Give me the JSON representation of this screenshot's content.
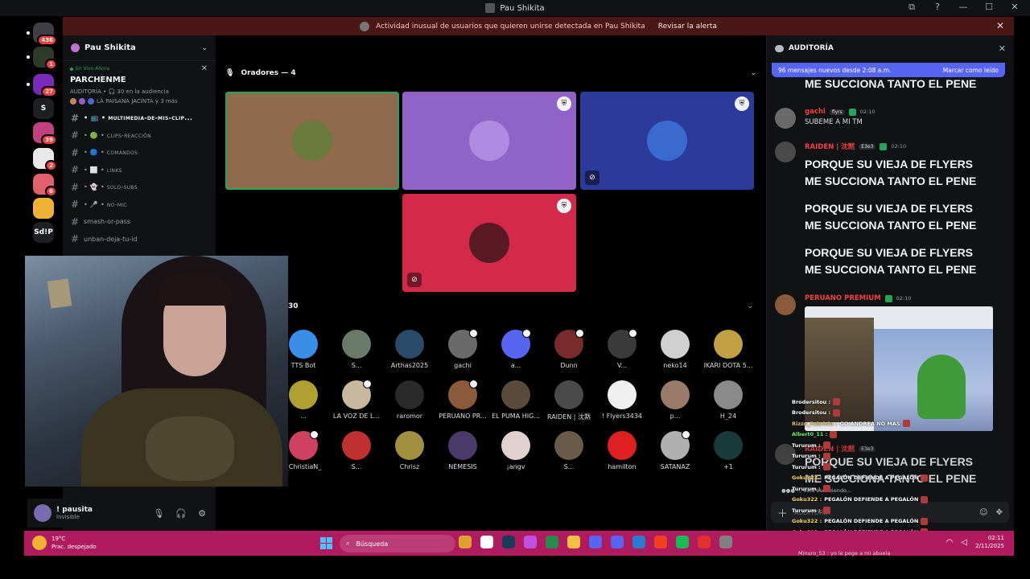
{
  "window": {
    "title": "Pau Shikita",
    "controls": [
      "⧉",
      "?",
      "—",
      "☐",
      "✕"
    ]
  },
  "alert": {
    "text": "Actividad inusual de usuarios que quieren unirse detectada en Pau Shikita",
    "link": "Revisar la alerta"
  },
  "rail": [
    {
      "label": "",
      "badge": "436",
      "color": "#3d3f45"
    },
    {
      "label": "",
      "badge": "1",
      "color": "#2d3a2a"
    },
    {
      "label": "",
      "badge": "27",
      "color": "#7a2ab8"
    },
    {
      "label": "S",
      "badge": "",
      "color": "#1e1f22"
    },
    {
      "label": "",
      "badge": "39",
      "color": "#c04080"
    },
    {
      "label": "",
      "badge": "2",
      "color": "#e8e8e8"
    },
    {
      "label": "",
      "badge": "6",
      "color": "#e06070"
    },
    {
      "label": "",
      "badge": "",
      "color": "#f0b232"
    },
    {
      "label": "Sd!P",
      "badge": "",
      "color": "#1e1f22"
    }
  ],
  "server": {
    "name": "Pau Shikita"
  },
  "live": {
    "tag": "En Vivo Ahora",
    "title": "PARCHENME",
    "meta": "AUDITORÍA • 🎧 30 en la audiencia",
    "hosts": "LA PAISANA JACINTA y 3 más"
  },
  "channels": [
    {
      "name": "• 📺 • multimedia-de-mis-clip...",
      "active": true
    },
    {
      "name": "• 🟢 • clips-reacción",
      "active": false
    },
    {
      "name": "• 🔵 • comandos",
      "active": false
    },
    {
      "name": "• ⬜ • links",
      "active": false
    },
    {
      "name": "• 👻 • solo-subs",
      "active": false
    },
    {
      "name": "• 🎤 • no-mic",
      "active": false
    },
    {
      "name": "smash-or-pass",
      "active": false
    },
    {
      "name": "unban-deja-tu-id",
      "active": false
    }
  ],
  "stage": {
    "speakers_label": "Oradores — 4",
    "tiles": [
      {
        "color": "#8f6a4c",
        "avatar": "#6a7a3a",
        "shield": false,
        "muted": false,
        "speaking": true
      },
      {
        "color": "#9063c9",
        "avatar": "#b08ae0",
        "shield": true,
        "muted": false,
        "speaking": false
      },
      {
        "color": "#2c3a9a",
        "avatar": "#3a6ad0",
        "shield": true,
        "muted": true,
        "speaking": false
      },
      {
        "color": "#d42a4a",
        "avatar": "#5a1a24",
        "shield": true,
        "muted": true,
        "speaking": false
      }
    ],
    "audience_count": "30",
    "audience": [
      {
        "name": "TTS Bot",
        "color": "#3a8ee8",
        "shield": false
      },
      {
        "name": "S...",
        "color": "#6a7a6a",
        "shield": false
      },
      {
        "name": "Arthas2025",
        "color": "#2a4a6a",
        "shield": false
      },
      {
        "name": "gachi",
        "color": "#6a6a6a",
        "shield": true
      },
      {
        "name": "a...",
        "color": "#5865f2",
        "shield": true
      },
      {
        "name": "Dunn",
        "color": "#7a2a2a",
        "shield": true
      },
      {
        "name": "V...",
        "color": "#3a3a3a",
        "shield": true
      },
      {
        "name": "neko14",
        "color": "#d0d0d0",
        "shield": false
      },
      {
        "name": "IKARI DOTA 5...",
        "color": "#c0a040",
        "shield": false
      },
      {
        "name": "...",
        "color": "#b0a030",
        "shield": false
      },
      {
        "name": "LA VOZ DE L...",
        "color": "#c8b8a0",
        "shield": true
      },
      {
        "name": "raromor",
        "color": "#2a2a2a",
        "shield": false
      },
      {
        "name": "PERUANO PR...",
        "color": "#8a5a3a",
        "shield": true
      },
      {
        "name": "EL PUMA HIG...",
        "color": "#5a4a3a",
        "shield": false
      },
      {
        "name": "RAIDEN | 沈黙",
        "color": "#4a4a4a",
        "shield": false
      },
      {
        "name": "! Flyers3434",
        "color": "#f0f0f0",
        "shield": false
      },
      {
        "name": "p...",
        "color": "#9a7a6a",
        "shield": false
      },
      {
        "name": "H_24",
        "color": "#8a8a8a",
        "shield": false
      },
      {
        "name": "_ChristiaN_",
        "color": "#d04060",
        "shield": true
      },
      {
        "name": "S...",
        "color": "#c03030",
        "shield": false
      },
      {
        "name": "Chrisz",
        "color": "#a09040",
        "shield": false
      },
      {
        "name": "NÉMESIS",
        "color": "#4a3a6a",
        "shield": false
      },
      {
        "name": "¡angv",
        "color": "#e0d0d0",
        "shield": false
      },
      {
        "name": "S...",
        "color": "#6a5a4a",
        "shield": false
      },
      {
        "name": "hamilton",
        "color": "#e02020",
        "shield": false
      },
      {
        "name": "SATANAZ",
        "color": "#b0b0b0",
        "shield": true
      },
      {
        "name": "+1",
        "color": "#1a3a3a",
        "shield": false
      }
    ]
  },
  "user": {
    "name": "! pausita",
    "status": "Invisible"
  },
  "chat": {
    "title": "AUDITORÍA",
    "new_messages": "96 mensajes nuevos desde 2:08 a.m.",
    "mark_read": "Marcar como leído",
    "top_line": "ME SUCCIONA TANTO EL PENE",
    "messages": [
      {
        "author": "gachi",
        "tag": "flyrs",
        "time": "02:10",
        "text": "SUBEME A MI TM",
        "color": "#f23f43",
        "avatar": "#6a6a6a"
      },
      {
        "author": "RAIDEN | 沈黙",
        "tag": "E3e3",
        "time": "02:10",
        "color": "#f23f43",
        "avatar": "#4a4a4a"
      }
    ],
    "shout_lines": [
      "PORQUE SU VIEJA DE FLYERS",
      "ME SUCCIONA TANTO EL PENE",
      "PORQUE SU VIEJA DE FLYERS",
      "ME SUCCIONA TANTO EL PENE",
      "PORQUE SU VIEJA DE FLYERS",
      "ME SUCCIONA TANTO EL PENE"
    ],
    "embed_author": {
      "author": "PERUANO PREMIUM",
      "time": "02:10",
      "color": "#f23f43",
      "avatar": "#8a5a3a"
    },
    "bg_message": {
      "author": "RAIDEN | 沈黙",
      "tag": "E3e3",
      "line1": "PORQUE SU VIEJA DE FLYERS",
      "line2": "ME SUCCIONA TANTO EL PENE"
    },
    "typing": "... está escribiendo...",
    "input_placeholder": "AUDITORÍA"
  },
  "overlay_chat": [
    {
      "user": "Brodersitou :",
      "text": "",
      "color": "#ffffff"
    },
    {
      "user": "Brodersitou :",
      "text": "",
      "color": "#ffffff"
    },
    {
      "user": "Rizzo_Fabricio :",
      "text": "GO ANDREA NO MAS",
      "color": "#e8c070"
    },
    {
      "user": "Albert0_11 :",
      "text": "",
      "color": "#6af06a"
    },
    {
      "user": "Tururum :",
      "text": "",
      "color": "#ffffff"
    },
    {
      "user": "Tururum :",
      "text": "",
      "color": "#ffffff"
    },
    {
      "user": "Tururum :",
      "text": "",
      "color": "#ffffff"
    },
    {
      "user": "Goku322 :",
      "text": "PEGALÓN DEFIENDE A PEGALÓN",
      "color": "#ffdd55"
    },
    {
      "user": "Tururum :",
      "text": "",
      "color": "#ffffff"
    },
    {
      "user": "Goku322 :",
      "text": "PEGALÓN DEFIENDE A PEGALÓN",
      "color": "#ffdd55"
    },
    {
      "user": "Tururum :",
      "text": "",
      "color": "#ffffff"
    },
    {
      "user": "Goku322 :",
      "text": "PEGALÓN DEFIENDE A PEGALÓN",
      "color": "#ffdd55"
    },
    {
      "user": "Goku322 :",
      "text": "PEGALÓN DEFIENDE A PEGALÓN",
      "color": "#ffdd55"
    },
    {
      "user": "omarfzz :",
      "text": "QUE TAL CPP",
      "color": "#ffffff"
    }
  ],
  "bottom_chat": "Minuro_53 : yo le pege a mi abuela",
  "taskbar": {
    "temp": "19°C",
    "weather": "Prac. despejado",
    "search": "Búsqueda",
    "time": "02:11",
    "date": "2/11/2025",
    "apps": [
      "#e0a030",
      "#ffffff",
      "#1a3a5a",
      "#c050e0",
      "#2a8a4a",
      "#f0c040",
      "#5865f2",
      "#5865f2",
      "#2a7ad0",
      "#f04020",
      "#1db954",
      "#e03030",
      "#808080"
    ]
  }
}
